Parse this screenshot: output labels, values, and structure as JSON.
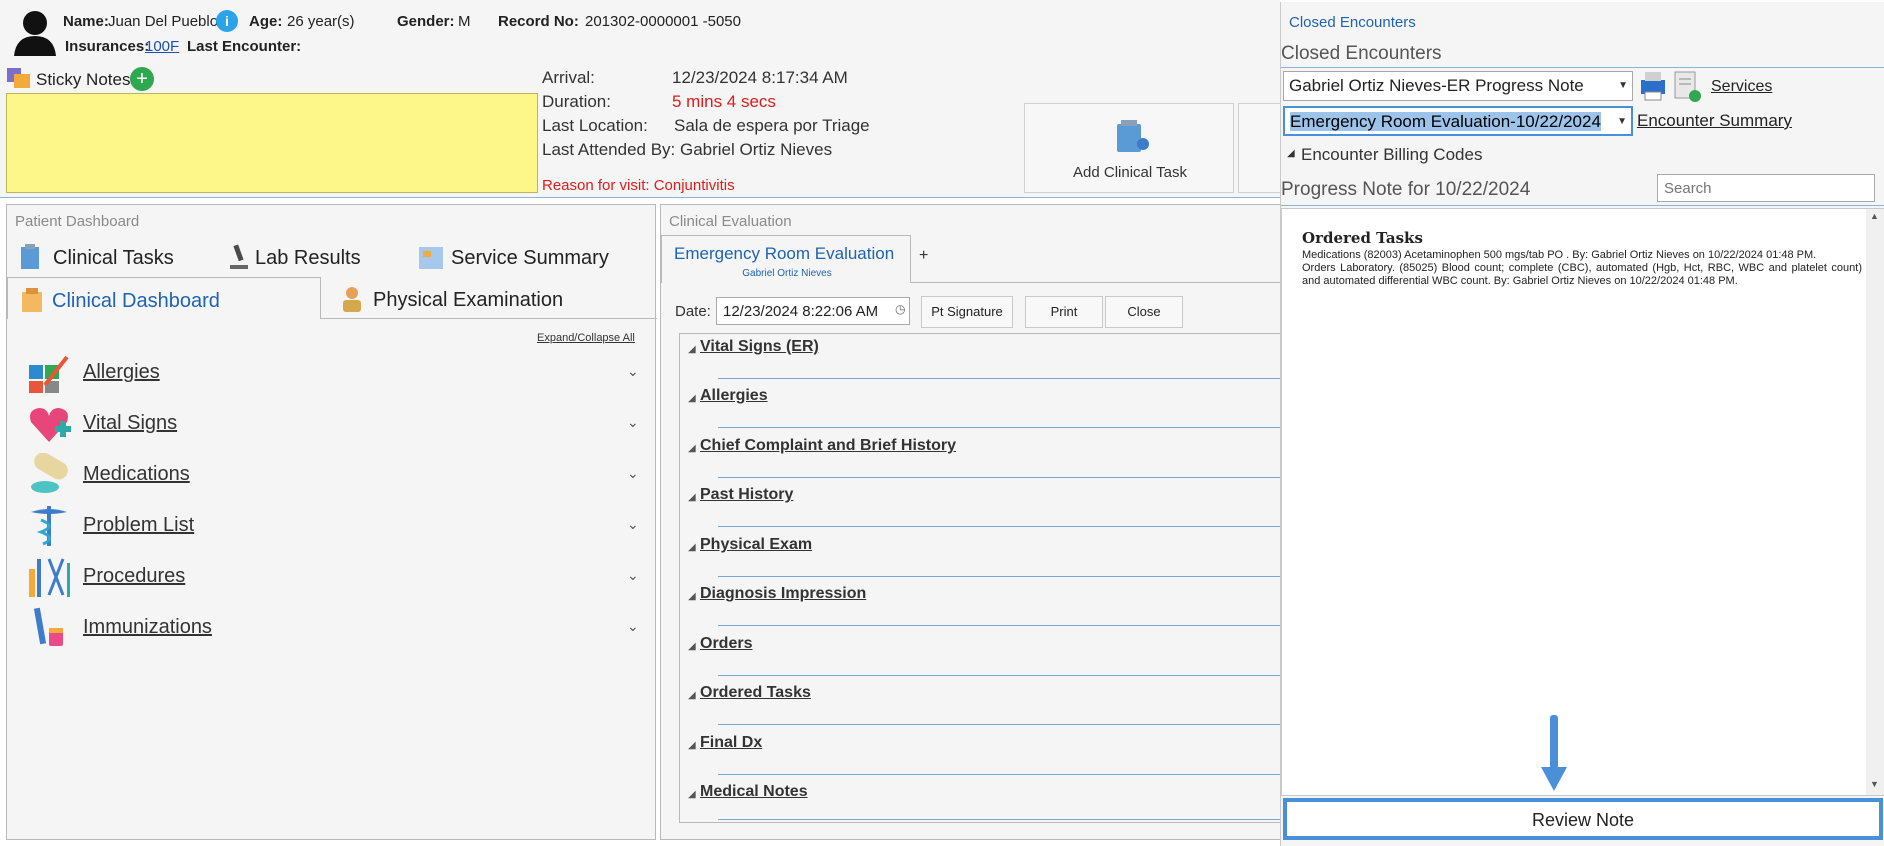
{
  "patient": {
    "name_label": "Name:",
    "name": "Juan Del Pueblo",
    "age_label": "Age:",
    "age": "26 year(s)",
    "gender_label": "Gender:",
    "gender": "M",
    "record_label": "Record No:",
    "record": "201302-0000001 -5050",
    "insurances_label": "Insurances:",
    "insurance": "100F",
    "last_encounter_label": "Last Encounter:"
  },
  "sticky": {
    "label": "Sticky Notes"
  },
  "visit": {
    "arrival_label": "Arrival:",
    "arrival": "12/23/2024 8:17:34 AM",
    "duration_label": "Duration:",
    "duration": "5 mins 4 secs",
    "location_label": "Last Location:",
    "location": "Sala de espera por Triage",
    "attended": "Last Attended By: Gabriel Ortiz Nieves",
    "reason": "Reason for visit: Conjuntivitis"
  },
  "tiles": {
    "add_task": "Add Clinical Task"
  },
  "dashboard": {
    "title": "Patient Dashboard",
    "tabs": [
      "Clinical Tasks",
      "Lab Results",
      "Service Summary",
      "Clinical Dashboard",
      "Physical Examination"
    ],
    "expand": "Expand/Collapse All",
    "items": [
      "Allergies",
      "Vital Signs",
      "Medications",
      "Problem List",
      "Procedures",
      "Immunizations"
    ]
  },
  "evaluation": {
    "title": "Clinical Evaluation",
    "tab": "Emergency Room Evaluation",
    "tab_sub": "Gabriel Ortiz Nieves",
    "plus": "+",
    "date_label": "Date:",
    "date": "12/23/2024 8:22:06 AM",
    "buttons": [
      "Pt Signature",
      "Print",
      "Close"
    ],
    "sections": [
      "Vital Signs (ER)",
      "Allergies",
      "Chief Complaint and Brief History",
      "Past History",
      "Physical Exam",
      "Diagnosis Impression",
      "Orders",
      "Ordered Tasks",
      "Final Dx",
      "Medical Notes"
    ]
  },
  "closed": {
    "link": "Closed Encounters",
    "heading": "Closed Encounters",
    "combo1": "Gabriel Ortiz Nieves-ER Progress Note",
    "services": "Services",
    "combo2": "Emergency Room Evaluation-10/22/2024",
    "summary": "Encounter Summary",
    "billing": "Encounter Billing Codes",
    "progress": "Progress Note for 10/22/2024",
    "search_placeholder": "Search",
    "note_title": "Ordered Tasks",
    "note_line1": "Medications (82003) Acetaminophen 500 mgs/tab PO . By: Gabriel Ortiz Nieves on 10/22/2024 01:48 PM.",
    "note_line2": "Orders Laboratory. (85025) Blood count; complete (CBC), automated (Hgb, Hct, RBC, WBC and platelet count) and automated differential WBC count. By: Gabriel Ortiz Nieves on 10/22/2024 01:48 PM.",
    "review": "Review Note"
  },
  "colors": {
    "accent": "#1e63b0",
    "red": "#e01b1b",
    "sticky": "#fdf78a",
    "highlight": "#4a90d9"
  }
}
